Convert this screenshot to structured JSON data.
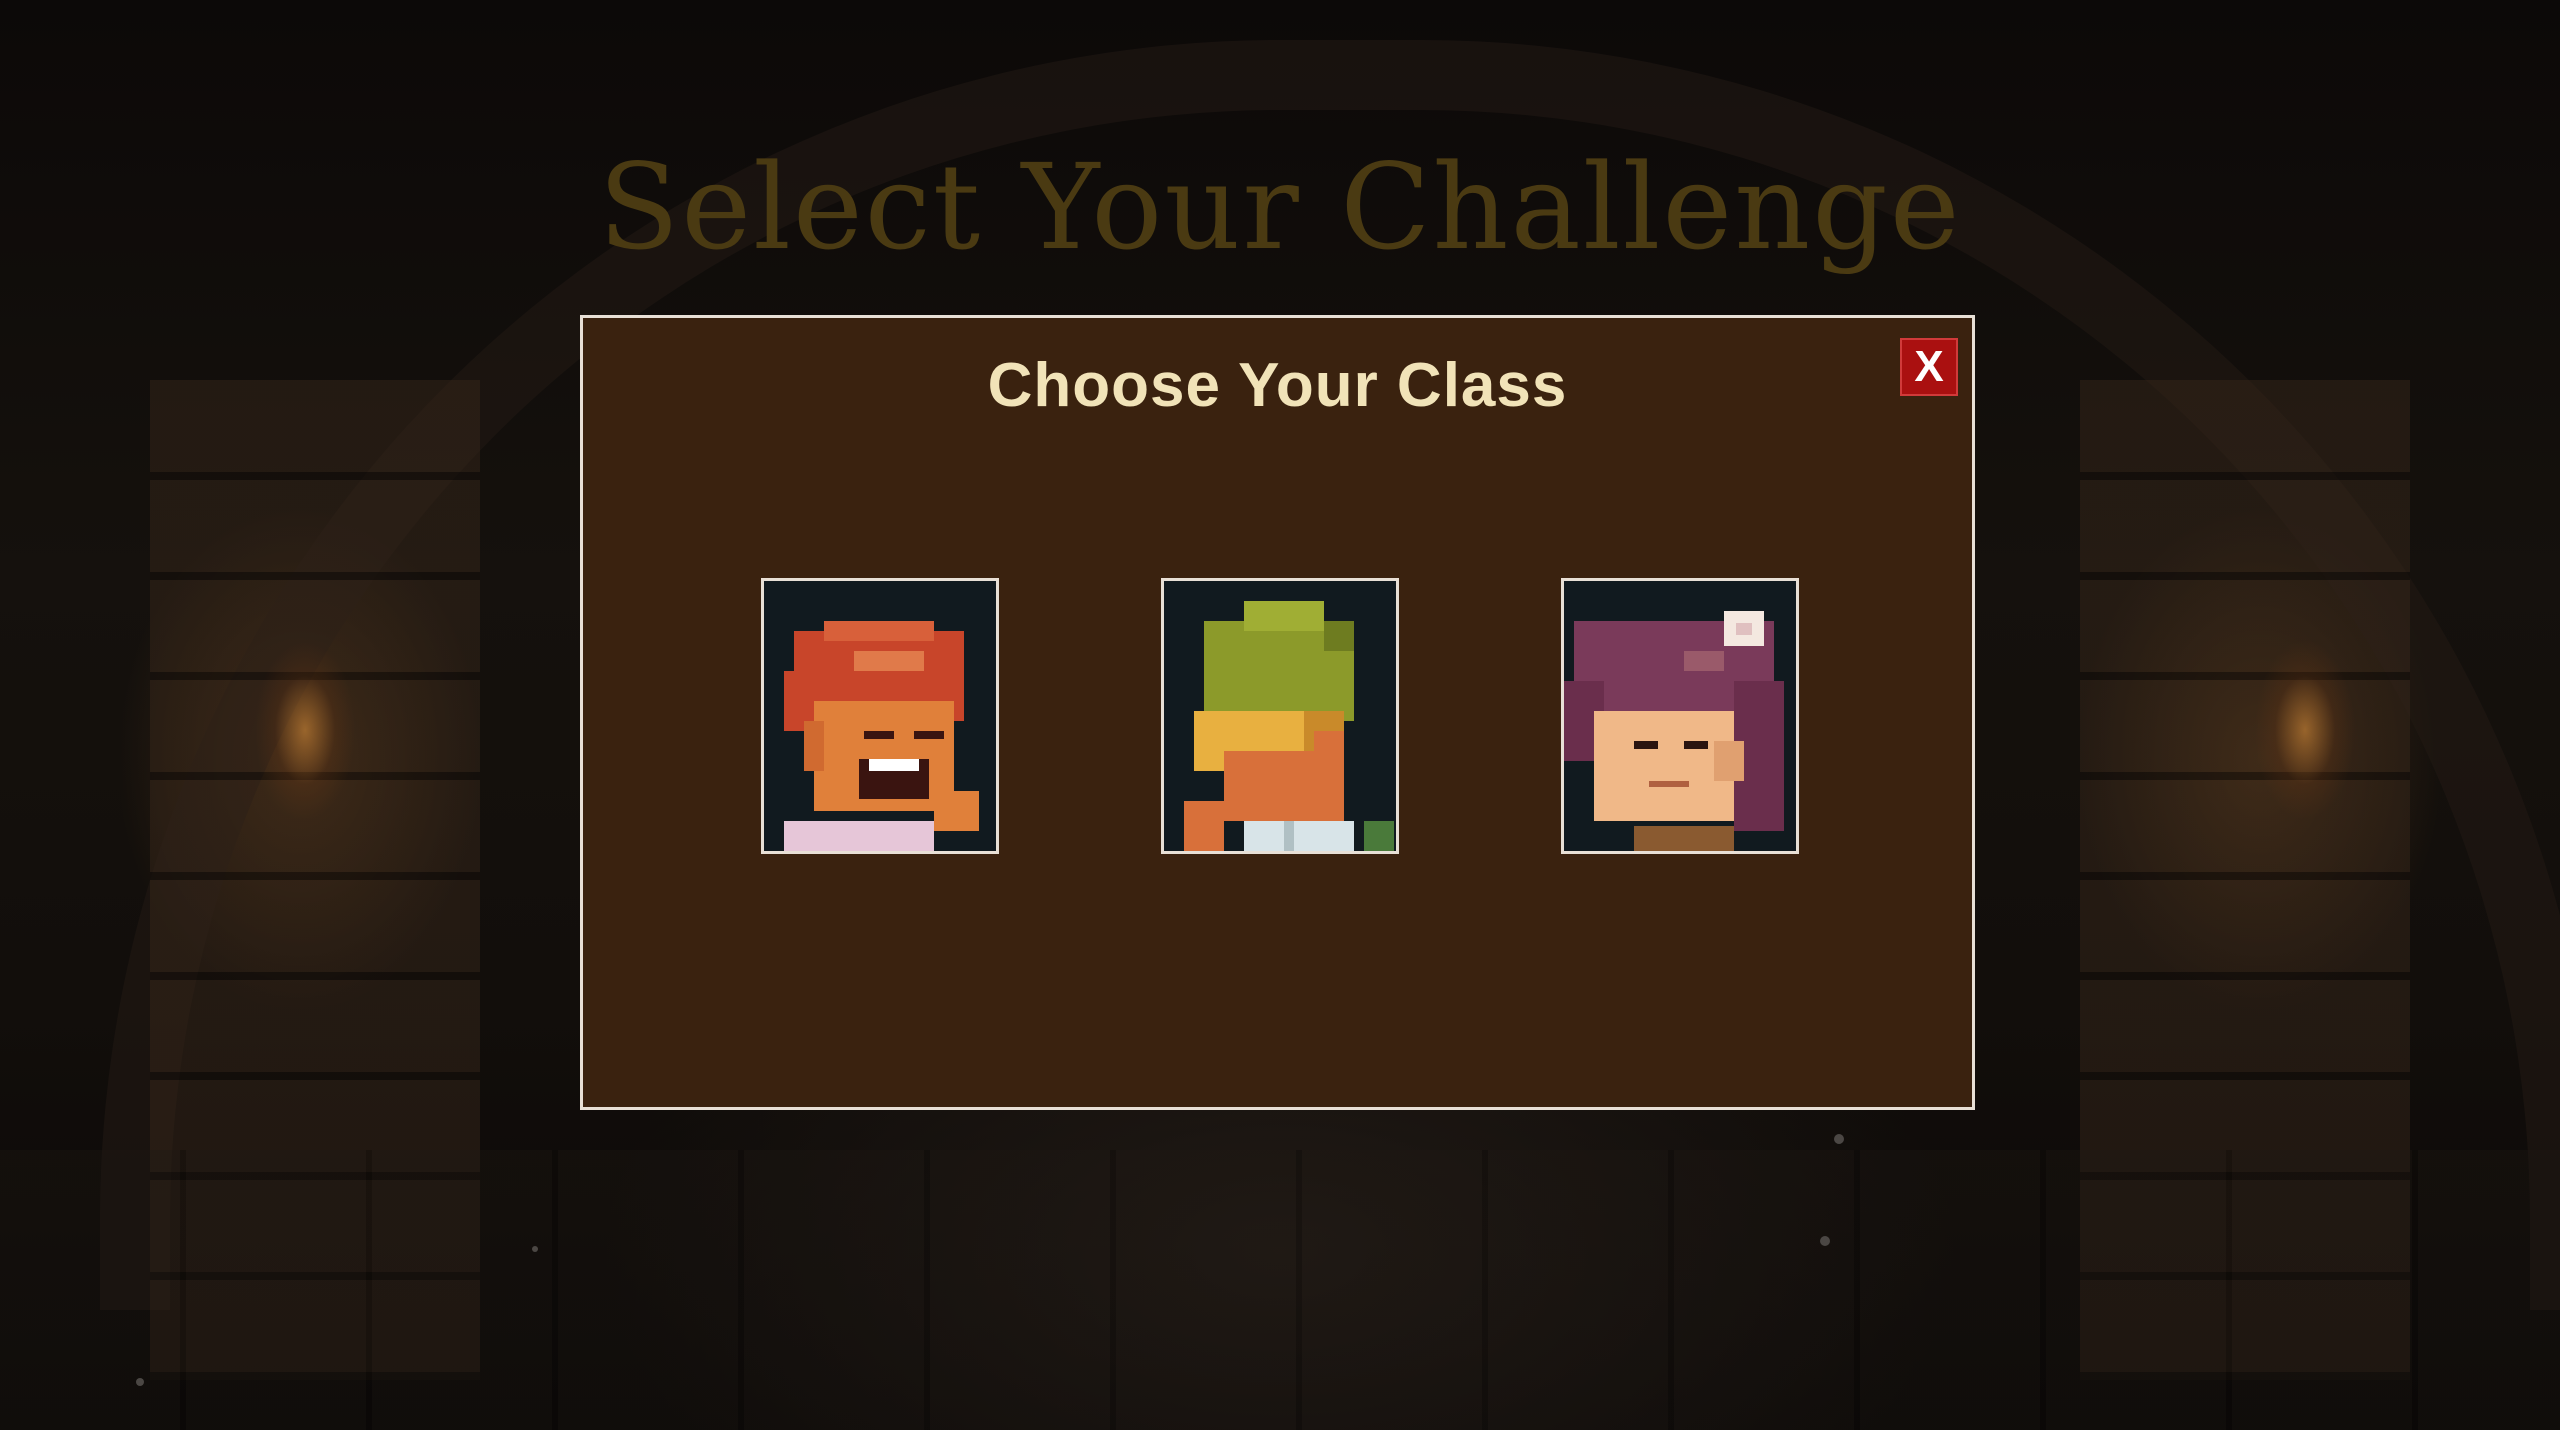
{
  "screen": {
    "title": "Select Your Challenge"
  },
  "modal": {
    "title": "Choose Your Class",
    "close_label": "X",
    "classes": [
      {
        "portrait": "red-haired-hero-portrait"
      },
      {
        "portrait": "green-hat-hero-portrait"
      },
      {
        "portrait": "purple-haired-hero-portrait"
      }
    ]
  },
  "colors": {
    "modal_bg": "#3a220f",
    "modal_border": "#e8e0d6",
    "title_text": "#f1e3b8",
    "close_button": "#aa1010",
    "screen_title": "#4a3a12"
  }
}
